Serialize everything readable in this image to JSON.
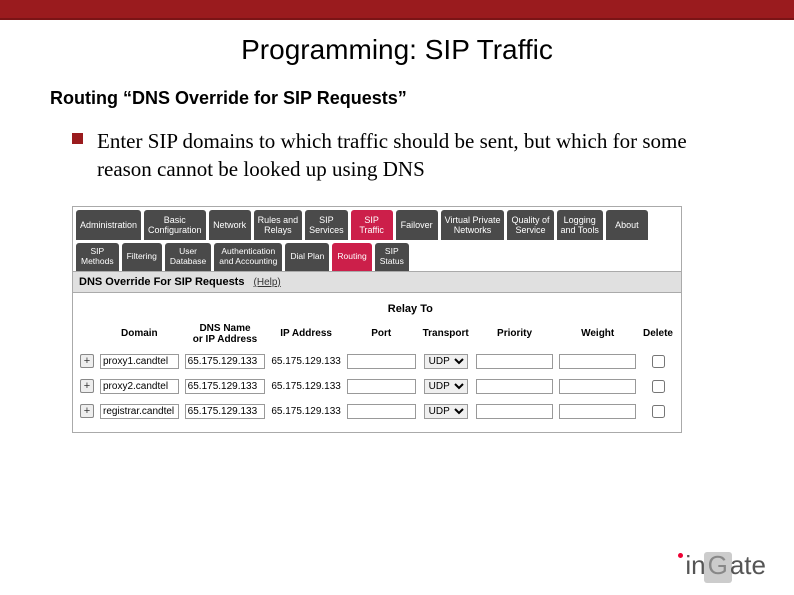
{
  "header": {
    "title": "Programming: SIP Traffic"
  },
  "subtitle": "Routing “DNS Override for SIP Requests”",
  "bullet": "Enter SIP domains to which traffic should be sent, but which for some reason cannot be looked up using DNS",
  "tabs_primary": [
    {
      "label": "Administration",
      "active": false
    },
    {
      "label": "Basic\nConfiguration",
      "active": false
    },
    {
      "label": "Network",
      "active": false
    },
    {
      "label": "Rules and\nRelays",
      "active": false
    },
    {
      "label": "SIP\nServices",
      "active": false
    },
    {
      "label": "SIP\nTraffic",
      "active": true
    },
    {
      "label": "Failover",
      "active": false
    },
    {
      "label": "Virtual Private\nNetworks",
      "active": false
    },
    {
      "label": "Quality of\nService",
      "active": false
    },
    {
      "label": "Logging\nand Tools",
      "active": false
    },
    {
      "label": "About",
      "active": false
    }
  ],
  "tabs_secondary": [
    {
      "label": "SIP\nMethods",
      "active": false
    },
    {
      "label": "Filtering",
      "active": false
    },
    {
      "label": "User\nDatabase",
      "active": false
    },
    {
      "label": "Authentication\nand Accounting",
      "active": false
    },
    {
      "label": "Dial Plan",
      "active": false
    },
    {
      "label": "Routing",
      "active": true
    },
    {
      "label": "SIP\nStatus",
      "active": false
    }
  ],
  "section": {
    "title": "DNS Override For SIP Requests",
    "help": "(Help)"
  },
  "table": {
    "group_header": "Relay To",
    "columns": {
      "domain": "Domain",
      "dns": "DNS Name\nor IP Address",
      "ip": "IP Address",
      "port": "Port",
      "transport": "Transport",
      "priority": "Priority",
      "weight": "Weight",
      "delete": "Delete"
    },
    "rows": [
      {
        "domain": "proxy1.candtel",
        "dns": "65.175.129.133",
        "ip": "65.175.129.133",
        "port": "",
        "transport": "UDP",
        "priority": "",
        "weight": ""
      },
      {
        "domain": "proxy2.candtel",
        "dns": "65.175.129.133",
        "ip": "65.175.129.133",
        "port": "",
        "transport": "UDP",
        "priority": "",
        "weight": ""
      },
      {
        "domain": "registrar.candtel",
        "dns": "65.175.129.133",
        "ip": "65.175.129.133",
        "port": "",
        "transport": "UDP",
        "priority": "",
        "weight": ""
      }
    ],
    "transport_options": [
      "UDP"
    ],
    "add_label": "+"
  },
  "logo": {
    "in": "in",
    "g": "G",
    "ate": "ate"
  }
}
